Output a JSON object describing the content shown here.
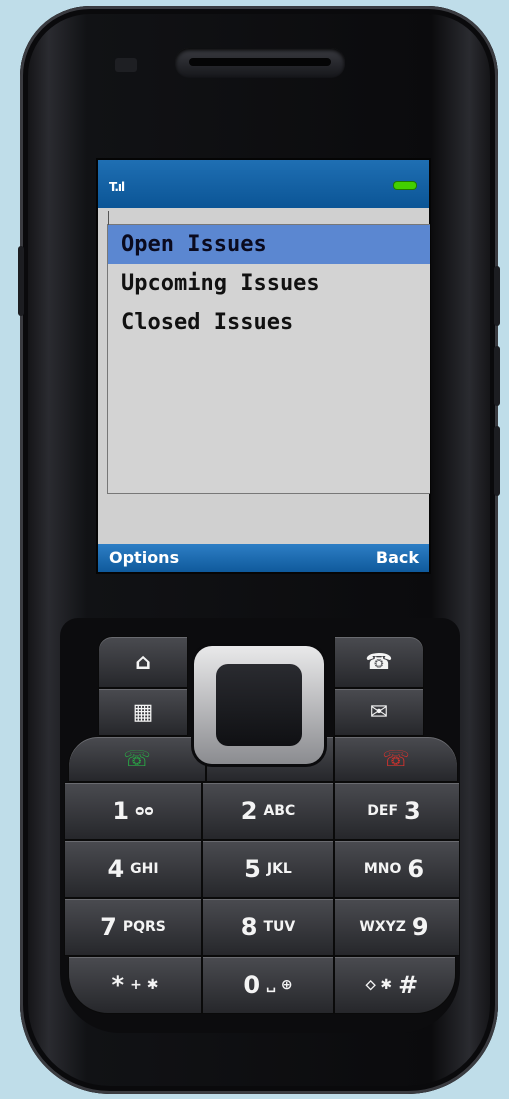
{
  "screen": {
    "status": {
      "signal_icon": "signal-icon",
      "battery_icon": "battery-icon"
    },
    "menu_items": [
      {
        "label": "Open Issues",
        "selected": true
      },
      {
        "label": "Upcoming Issues",
        "selected": false
      },
      {
        "label": "Closed Issues",
        "selected": false
      }
    ],
    "softkeys": {
      "left": "Options",
      "right": "Back"
    }
  },
  "colors": {
    "status_bar": "#0b5596",
    "selection": "#5b87d1",
    "list_background": "#d3d3d3",
    "accent": "#2aa3d8"
  },
  "keypad": {
    "rows": [
      [
        {
          "num": "1",
          "letters": "ᴑᴑ"
        },
        {
          "num": "2",
          "letters": "ABC"
        },
        {
          "num": "3",
          "letters": "DEF"
        }
      ],
      [
        {
          "num": "4",
          "letters": "GHI"
        },
        {
          "num": "5",
          "letters": "JKL"
        },
        {
          "num": "6",
          "letters": "MNO"
        }
      ],
      [
        {
          "num": "7",
          "letters": "PQRS"
        },
        {
          "num": "8",
          "letters": "TUV"
        },
        {
          "num": "9",
          "letters": "WXYZ"
        }
      ],
      [
        {
          "num": "*",
          "letters": "+ ✱"
        },
        {
          "num": "0",
          "letters": "␣ ⊕"
        },
        {
          "num": "#",
          "letters": "⬦ ✱"
        }
      ]
    ],
    "function_keys": {
      "home": "⌂",
      "calendar": "▦",
      "contacts": "☎",
      "mail": "✉",
      "clear": "⌫"
    }
  }
}
